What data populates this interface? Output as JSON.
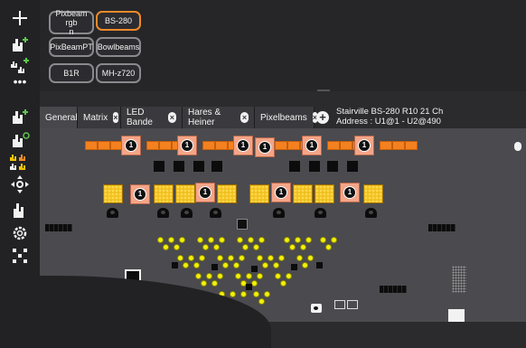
{
  "fixture_types": [
    {
      "label": "Pixbeam rgb\nn",
      "selected": false
    },
    {
      "label": "BS-280",
      "selected": true
    },
    {
      "label": "PixBeamPT",
      "selected": false
    },
    {
      "label": "Bowlbeams",
      "selected": false
    },
    {
      "label": "B1R",
      "selected": false
    },
    {
      "label": "MH-z720",
      "selected": false
    }
  ],
  "tabs": [
    {
      "label": "General",
      "closable": false,
      "active": true
    },
    {
      "label": "Matrix",
      "closable": true,
      "active": false
    },
    {
      "label": "LED Bande",
      "closable": true,
      "active": false
    },
    {
      "label": "Hares & Heiner",
      "closable": true,
      "active": false
    },
    {
      "label": "Pixelbeams",
      "closable": true,
      "active": false
    }
  ],
  "fixture_info": {
    "line1": "Stairville BS-280 R10 21 Ch",
    "line2": "Address : U1@1 - U2@490"
  },
  "stage": {
    "head_label": "1"
  },
  "icons": {
    "add": "plus-icon",
    "menu": "more-icon"
  },
  "colors": {
    "selected_border": "#f08a2a",
    "orange_cells": "#f4811f",
    "yellow_dots": "#f3f00a",
    "stage_bg": "#4a4a4f"
  }
}
